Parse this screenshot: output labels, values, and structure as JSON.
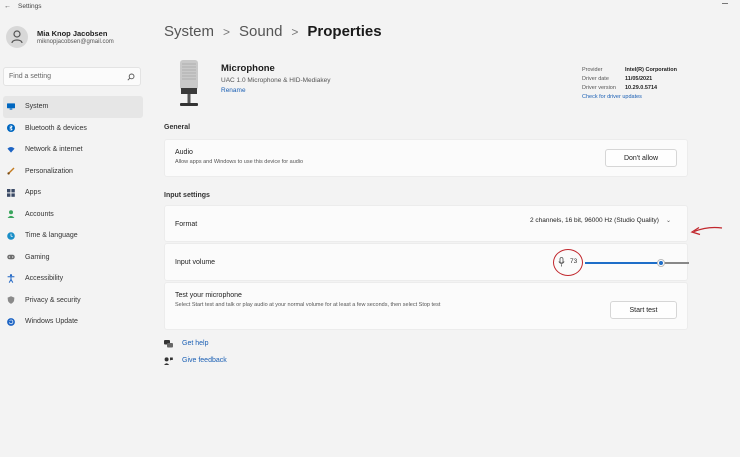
{
  "window": {
    "title": "Settings"
  },
  "profile": {
    "name": "Mia Knop Jacobsen",
    "email": "miknopjacobsen@gmail.com"
  },
  "search": {
    "placeholder": "Find a setting"
  },
  "nav": {
    "items": [
      {
        "label": "System",
        "icon": "system-icon",
        "color": "#0067c0"
      },
      {
        "label": "Bluetooth & devices",
        "icon": "bluetooth-icon",
        "color": "#0067c0"
      },
      {
        "label": "Network & internet",
        "icon": "wifi-icon",
        "color": "#1d64c4"
      },
      {
        "label": "Personalization",
        "icon": "brush-icon",
        "color": "#c47a1d"
      },
      {
        "label": "Apps",
        "icon": "apps-icon",
        "color": "#3b4a66"
      },
      {
        "label": "Accounts",
        "icon": "person-icon",
        "color": "#3aa55d"
      },
      {
        "label": "Time & language",
        "icon": "globe-clock-icon",
        "color": "#1a8ec7"
      },
      {
        "label": "Gaming",
        "icon": "gamepad-icon",
        "color": "#6b6b6b"
      },
      {
        "label": "Accessibility",
        "icon": "accessibility-icon",
        "color": "#1d64c4"
      },
      {
        "label": "Privacy & security",
        "icon": "shield-icon",
        "color": "#777777"
      },
      {
        "label": "Windows Update",
        "icon": "update-icon",
        "color": "#1d64c4"
      }
    ],
    "active_index": 0
  },
  "breadcrumb": {
    "level1": "System",
    "sep1": ">",
    "level2": "Sound",
    "sep2": ">",
    "current": "Properties"
  },
  "device": {
    "name": "Microphone",
    "description": "UAC 1.0 Microphone & HID-Mediakey",
    "rename_link": "Rename",
    "driver": {
      "provider_label": "Provider",
      "provider": "Intel(R) Corporation",
      "date_label": "Driver date",
      "date": "11/05/2021",
      "version_label": "Driver version",
      "version": "10.29.0.5714",
      "update_link": "Check for driver updates"
    }
  },
  "general": {
    "section_label": "General",
    "audio": {
      "title": "Audio",
      "subtitle": "Allow apps and Windows to use this device for audio",
      "button": "Don't allow"
    }
  },
  "input_settings": {
    "section_label": "Input settings",
    "format": {
      "label": "Format",
      "value": "2 channels, 16 bit, 96000 Hz (Studio Quality)"
    },
    "volume": {
      "label": "Input volume",
      "value": "73",
      "level": 0.73
    },
    "test": {
      "title": "Test your microphone",
      "subtitle": "Select Start test and talk or play audio at your normal volume for at least a few seconds, then select Stop test",
      "button": "Start test"
    }
  },
  "help": {
    "get_help": "Get help",
    "give_feedback": "Give feedback"
  },
  "colors": {
    "accent": "#1e6ec8",
    "annotation": "#c1272d",
    "link": "#1a5fb4"
  }
}
